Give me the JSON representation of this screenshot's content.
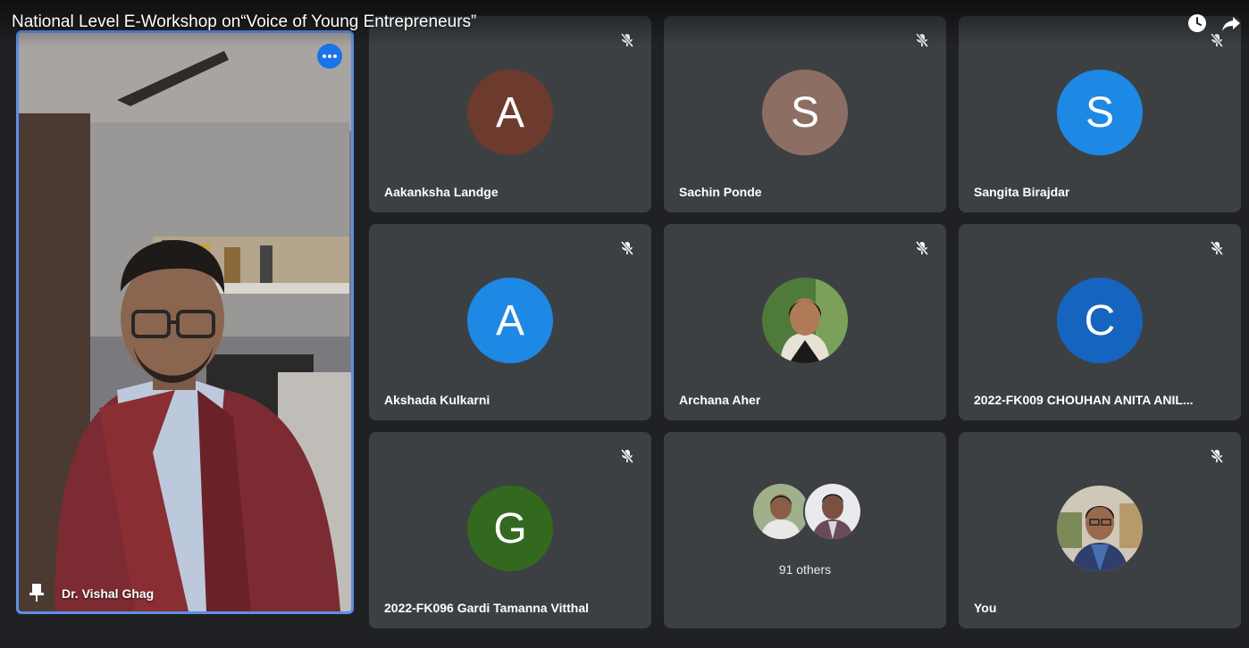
{
  "video": {
    "title": "National Level E-Workshop on“Voice of Young Entrepreneurs”",
    "icons": [
      "clock-icon",
      "share-icon"
    ]
  },
  "presenter": {
    "name": "Dr. Vishal Ghag",
    "icons": [
      "more-options-icon",
      "pin-icon"
    ]
  },
  "tiles": [
    {
      "initial": "A",
      "name": "Aakanksha Landge",
      "color": "#6d3a2e"
    },
    {
      "initial": "S",
      "name": "Sachin Ponde",
      "color": "#8d6e63"
    },
    {
      "initial": "S",
      "name": "Sangita Birajdar",
      "color": "#1e88e5"
    },
    {
      "initial": "A",
      "name": "Akshada Kulkarni",
      "color": "#1e88e5"
    },
    {
      "initial": "",
      "name": "Archana Aher",
      "color": "#3d5a3a"
    },
    {
      "initial": "C",
      "name": "2022-FK009 CHOUHAN ANITA ANIL...",
      "color": "#1565c0"
    },
    {
      "initial": "G",
      "name": "2022-FK096 Gardi Tamanna Vitthal",
      "color": "#33691e"
    },
    {
      "others_label": "91 others"
    },
    {
      "name": "You"
    }
  ],
  "colors": {
    "background": "#202124",
    "tile": "#3c4043",
    "presenter_border": "#5e8fe6",
    "accent": "#1a73e8"
  }
}
